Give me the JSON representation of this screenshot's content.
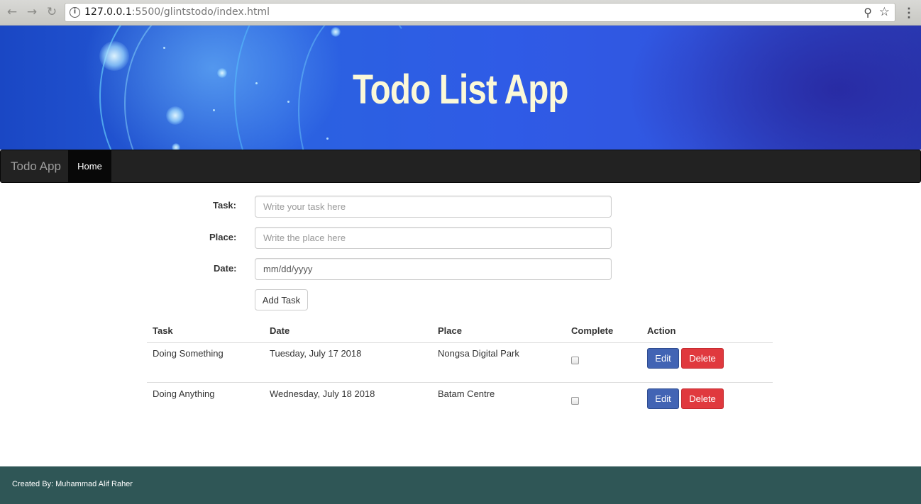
{
  "browser": {
    "url_host": "127.0.0.1",
    "url_rest": ":5500/glintstodo/index.html",
    "back_icon": "back-arrow-icon",
    "forward_icon": "forward-arrow-icon",
    "reload_icon": "reload-icon",
    "info_icon": "info-icon",
    "zoom_icon": "zoom-icon",
    "star_icon": "bookmark-star-icon",
    "menu_icon": "kebab-menu-icon"
  },
  "banner": {
    "title": "Todo List App"
  },
  "navbar": {
    "brand": "Todo App",
    "home": "Home"
  },
  "form": {
    "task_label": "Task:",
    "task_placeholder": "Write your task here",
    "place_label": "Place:",
    "place_placeholder": "Write the place here",
    "date_label": "Date:",
    "date_value": "mm/dd/yyyy",
    "add_button": "Add Task"
  },
  "table": {
    "headers": {
      "task": "Task",
      "date": "Date",
      "place": "Place",
      "complete": "Complete",
      "action": "Action"
    },
    "rows": [
      {
        "task": "Doing Something",
        "date": "Tuesday, July 17 2018",
        "place": "Nongsa Digital Park",
        "complete": false,
        "edit": "Edit",
        "delete": "Delete"
      },
      {
        "task": "Doing Anything",
        "date": "Wednesday, July 18 2018",
        "place": "Batam Centre",
        "complete": false,
        "edit": "Edit",
        "delete": "Delete"
      }
    ]
  },
  "footer": {
    "text": "Created By: Muhammad Alif Raher"
  },
  "colors": {
    "navbar": "#222222",
    "footer": "#2f5656",
    "edit": "#4264b4",
    "delete": "#e0393e",
    "banner_title": "#fbf8d8"
  }
}
